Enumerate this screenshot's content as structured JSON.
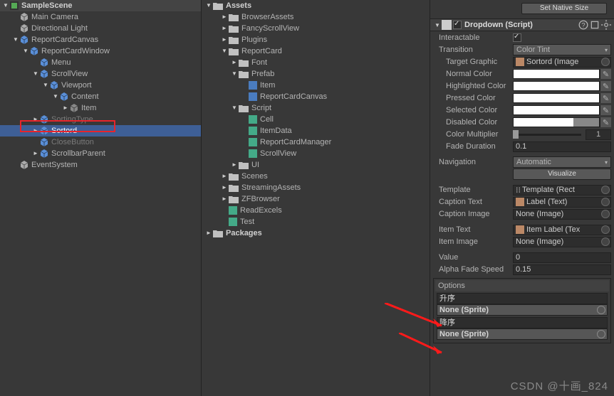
{
  "hierarchy": {
    "scene": "SampleScene",
    "items": [
      {
        "l": "Main Camera",
        "d": 1,
        "f": "",
        "sel": 0,
        "fd": 0
      },
      {
        "l": "Directional Light",
        "d": 1,
        "f": "",
        "sel": 0,
        "fd": 0
      },
      {
        "l": "ReportCardCanvas",
        "d": 1,
        "f": "▼",
        "sel": 0,
        "fd": 0,
        "blue": 1
      },
      {
        "l": "ReportCardWindow",
        "d": 2,
        "f": "▼",
        "sel": 0,
        "fd": 0,
        "blue": 1
      },
      {
        "l": "Menu",
        "d": 3,
        "f": "",
        "sel": 0,
        "fd": 0,
        "blue": 1
      },
      {
        "l": "ScrollView",
        "d": 3,
        "f": "▼",
        "sel": 0,
        "fd": 0,
        "blue": 1
      },
      {
        "l": "Viewport",
        "d": 4,
        "f": "▼",
        "sel": 0,
        "fd": 0,
        "blue": 1
      },
      {
        "l": "Content",
        "d": 5,
        "f": "▼",
        "sel": 0,
        "fd": 0,
        "blue": 1
      },
      {
        "l": "Item",
        "d": 6,
        "f": "►",
        "sel": 0,
        "fd": 0,
        "grey": 1
      },
      {
        "l": "SortingType",
        "d": 3,
        "f": "►",
        "sel": 0,
        "fd": 1,
        "blue": 1
      },
      {
        "l": "Sortord",
        "d": 3,
        "f": "►",
        "sel": 1,
        "fd": 0,
        "blue": 1
      },
      {
        "l": "CloseButton",
        "d": 3,
        "f": "",
        "sel": 0,
        "fd": 1,
        "blue": 1
      },
      {
        "l": "ScrollbarParent",
        "d": 3,
        "f": "►",
        "sel": 0,
        "fd": 0,
        "blue": 1
      },
      {
        "l": "EventSystem",
        "d": 1,
        "f": "",
        "sel": 0,
        "fd": 0
      }
    ]
  },
  "project": {
    "root": "Assets",
    "items": [
      {
        "l": "BrowserAssets",
        "d": 1,
        "f": "►",
        "t": "folder"
      },
      {
        "l": "FancyScrollView",
        "d": 1,
        "f": "►",
        "t": "folder"
      },
      {
        "l": "Plugins",
        "d": 1,
        "f": "►",
        "t": "folder"
      },
      {
        "l": "ReportCard",
        "d": 1,
        "f": "▼",
        "t": "folder"
      },
      {
        "l": "Font",
        "d": 2,
        "f": "►",
        "t": "folder"
      },
      {
        "l": "Prefab",
        "d": 2,
        "f": "▼",
        "t": "folder"
      },
      {
        "l": "Item",
        "d": 3,
        "f": "",
        "t": "prefab"
      },
      {
        "l": "ReportCardCanvas",
        "d": 3,
        "f": "",
        "t": "prefab"
      },
      {
        "l": "Script",
        "d": 2,
        "f": "▼",
        "t": "folder"
      },
      {
        "l": "Cell",
        "d": 3,
        "f": "",
        "t": "cs"
      },
      {
        "l": "ItemData",
        "d": 3,
        "f": "",
        "t": "cs"
      },
      {
        "l": "ReportCardManager",
        "d": 3,
        "f": "",
        "t": "cs"
      },
      {
        "l": "ScrollView",
        "d": 3,
        "f": "",
        "t": "cs"
      },
      {
        "l": "UI",
        "d": 2,
        "f": "►",
        "t": "folder"
      },
      {
        "l": "Scenes",
        "d": 1,
        "f": "►",
        "t": "folder"
      },
      {
        "l": "StreamingAssets",
        "d": 1,
        "f": "►",
        "t": "folder"
      },
      {
        "l": "ZFBrowser",
        "d": 1,
        "f": "►",
        "t": "folder"
      },
      {
        "l": "ReadExcels",
        "d": 1,
        "f": "",
        "t": "cs"
      },
      {
        "l": "Test",
        "d": 1,
        "f": "",
        "t": "cs"
      }
    ],
    "packages": "Packages"
  },
  "inspector": {
    "setNative": "Set Native Size",
    "component": "Dropdown (Script)",
    "interactable": {
      "label": "Interactable",
      "value": true
    },
    "transition": {
      "label": "Transition",
      "value": "Color Tint"
    },
    "targetGraphic": {
      "label": "Target Graphic",
      "value": "Sortord (Image"
    },
    "normalColor": "Normal Color",
    "highlightedColor": "Highlighted Color",
    "pressedColor": "Pressed Color",
    "selectedColor": "Selected Color",
    "disabledColor": "Disabled Color",
    "colorMultiplier": {
      "label": "Color Multiplier",
      "value": "1"
    },
    "fadeDuration": {
      "label": "Fade Duration",
      "value": "0.1"
    },
    "navigation": {
      "label": "Navigation",
      "value": "Automatic"
    },
    "visualize": "Visualize",
    "template": {
      "label": "Template",
      "value": "Template (Rect"
    },
    "captionText": {
      "label": "Caption Text",
      "value": "Label (Text)"
    },
    "captionImage": {
      "label": "Caption Image",
      "value": "None (Image)"
    },
    "itemText": {
      "label": "Item Text",
      "value": "Item Label (Tex"
    },
    "itemImage": {
      "label": "Item Image",
      "value": "None (Image)"
    },
    "valueProp": {
      "label": "Value",
      "value": "0"
    },
    "alphaFade": {
      "label": "Alpha Fade Speed",
      "value": "0.15"
    },
    "options": {
      "label": "Options",
      "items": [
        {
          "text": "升序",
          "sprite": "None (Sprite)"
        },
        {
          "text": "降序",
          "sprite": "None (Sprite)"
        }
      ]
    }
  },
  "watermark": "CSDN @十画_824"
}
